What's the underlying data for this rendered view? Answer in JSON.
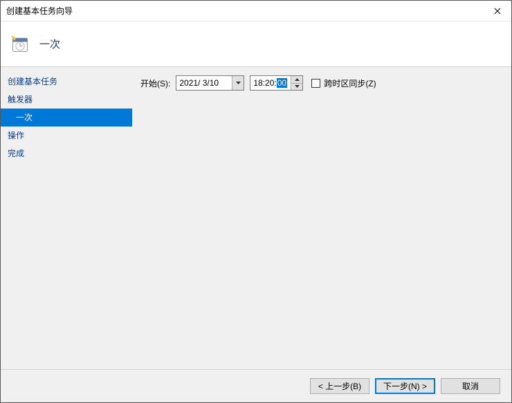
{
  "titlebar": {
    "title": "创建基本任务向导"
  },
  "header": {
    "title": "一次"
  },
  "sidebar": {
    "items": [
      {
        "label": "创建基本任务",
        "active": false,
        "indent": false
      },
      {
        "label": "触发器",
        "active": false,
        "indent": false
      },
      {
        "label": "一次",
        "active": true,
        "indent": true
      },
      {
        "label": "操作",
        "active": false,
        "indent": false
      },
      {
        "label": "完成",
        "active": false,
        "indent": false
      }
    ]
  },
  "content": {
    "start_label": "开始(S):",
    "date_value": "2021/ 3/10",
    "time_prefix": "18:20:",
    "time_selected": "00",
    "sync_label": "跨时区同步(Z)"
  },
  "footer": {
    "back": "< 上一步(B)",
    "next": "下一步(N) >",
    "cancel": "取消"
  }
}
